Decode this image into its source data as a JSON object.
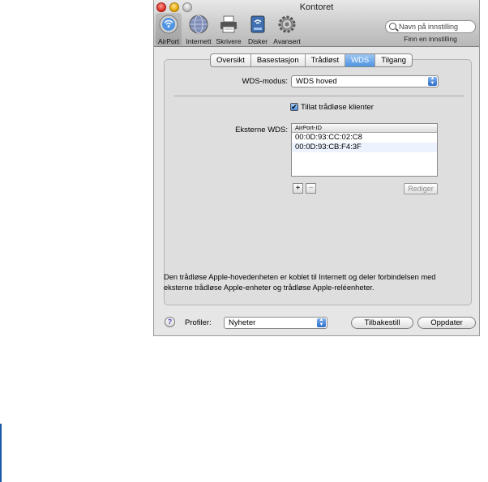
{
  "window": {
    "title": "Kontoret"
  },
  "toolbar": {
    "items": [
      {
        "label": "AirPort",
        "icon": "airport-icon"
      },
      {
        "label": "Internett",
        "icon": "globe-icon"
      },
      {
        "label": "Skrivere",
        "icon": "printer-icon"
      },
      {
        "label": "Disker",
        "icon": "disk-icon"
      },
      {
        "label": "Avansert",
        "icon": "gear-icon"
      }
    ],
    "selected": "AirPort",
    "search_placeholder": "Navn på innstilling",
    "search_caption": "Finn en innstilling"
  },
  "tabs": [
    {
      "label": "Oversikt",
      "active": false
    },
    {
      "label": "Basestasjon",
      "active": false
    },
    {
      "label": "Trådløst",
      "active": false
    },
    {
      "label": "WDS",
      "active": true
    },
    {
      "label": "Tilgang",
      "active": false
    }
  ],
  "wds": {
    "mode_label": "WDS-modus:",
    "mode_value": "WDS hoved",
    "allow_clients_label": "Tillat trådløse klienter",
    "allow_clients_checked": true,
    "external_label": "Eksterne WDS:",
    "list_header": "AirPort-ID",
    "entries": [
      "00:0D:93:CC:02:C8",
      "00:0D:93:CB:F4:3F"
    ],
    "add_label": "+",
    "remove_label": "−",
    "edit_label": "Rediger"
  },
  "description": "Den trådløse Apple-hovedenheten er koblet til Internett og deler forbindelsen med eksterne trådløse Apple-enheter og trådløse Apple-reléenheter.",
  "footer": {
    "help_label": "?",
    "profiles_label": "Profiler:",
    "profile_value": "Nyheter",
    "revert_label": "Tilbakestill",
    "update_label": "Oppdater"
  },
  "colors": {
    "accent": "#4f94e3",
    "selection_row": "#edf3fe"
  }
}
